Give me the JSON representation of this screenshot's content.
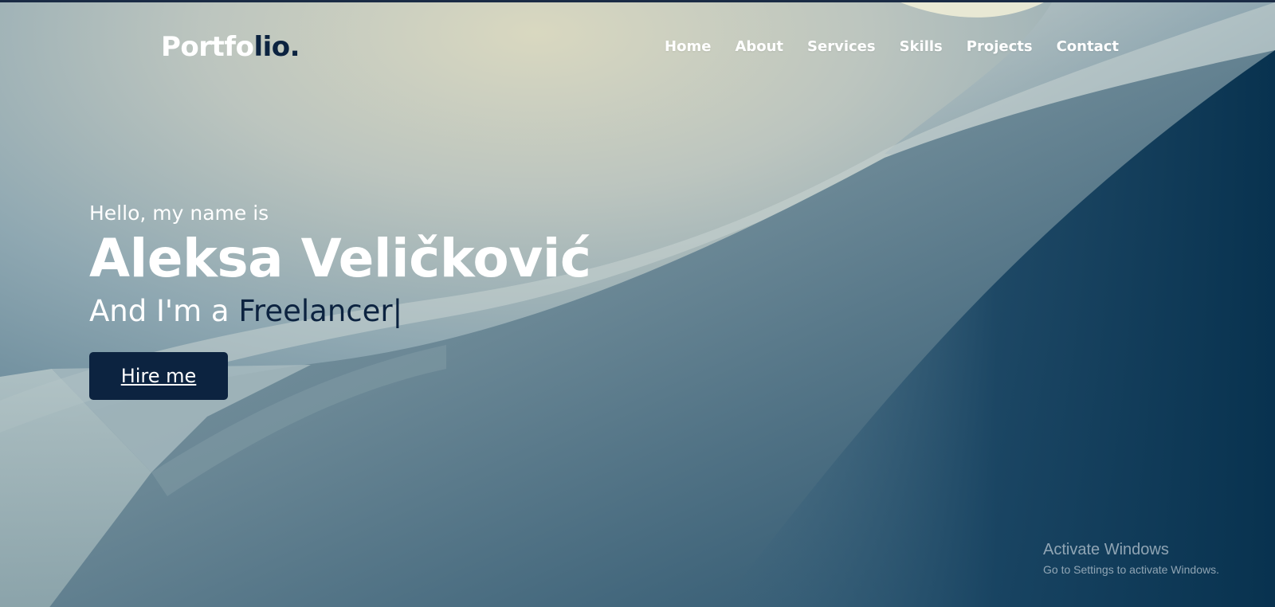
{
  "page": {
    "title": "Portfolio"
  },
  "logo": {
    "part_a": "Portfo",
    "part_b": "lio."
  },
  "nav": {
    "items": [
      {
        "label": "Home"
      },
      {
        "label": "About"
      },
      {
        "label": "Services"
      },
      {
        "label": "Skills"
      },
      {
        "label": "Projects"
      },
      {
        "label": "Contact"
      }
    ]
  },
  "hero": {
    "greeting": "Hello, my name is",
    "name": "Aleksa Veličković",
    "role_prefix": "And I'm a ",
    "role": "Freelancer",
    "cursor": "|",
    "button_label": "Hire me"
  },
  "watermark": {
    "line1": "Activate Windows",
    "line2": "Go to Settings to activate Windows."
  },
  "colors": {
    "accent": "#0c2340",
    "text_light": "#ffffff",
    "button_bg": "#0c2340"
  },
  "icons": {
    "background": "abstract-curved-wall-image"
  }
}
